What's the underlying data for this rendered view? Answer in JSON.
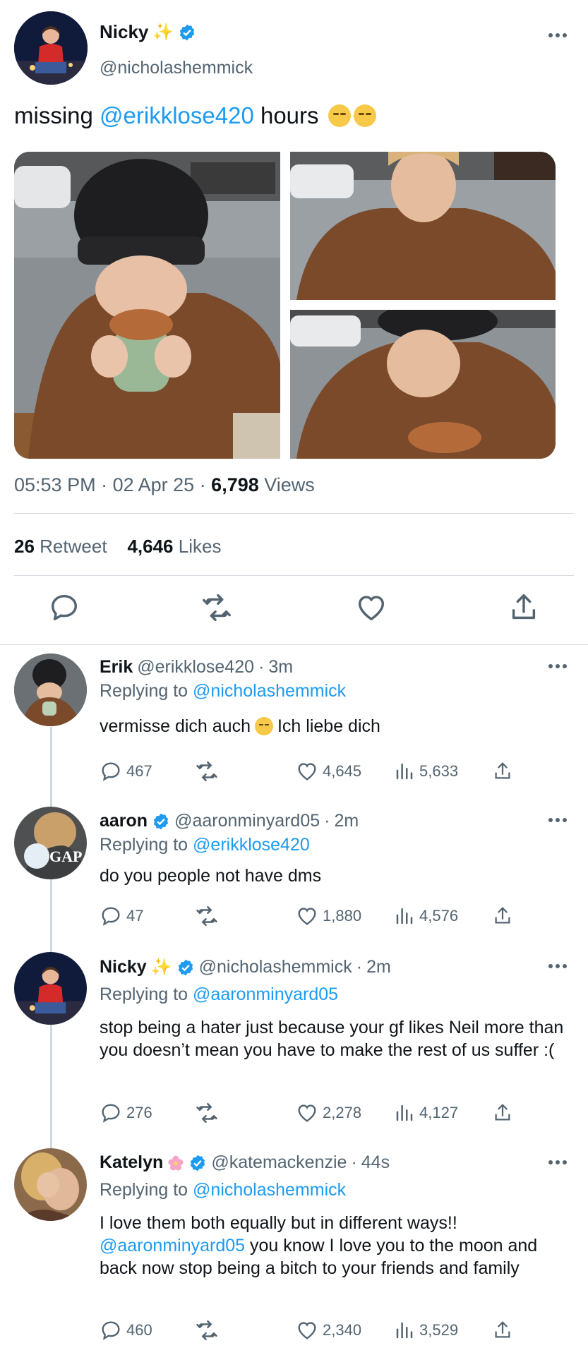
{
  "main_tweet": {
    "name": "Nicky",
    "handle": "@nicholashemmick",
    "text_before": "missing ",
    "mention": "@erikklose420",
    "text_after": " hours",
    "time": "05:53 PM",
    "date": "02 Apr 25",
    "views_count": "6,798",
    "views_label": "Views",
    "retweets_count": "26",
    "retweets_label": "Retweet",
    "likes_count": "4,646",
    "likes_label": "Likes"
  },
  "replies": [
    {
      "name": "Erik",
      "handle": "@erikklose420",
      "time": "3m",
      "replying_label": "Replying to",
      "replying_to": "@nicholashemmick",
      "text_before": "vermisse dich auch",
      "text_after": "Ich liebe dich",
      "comments": "467",
      "likes": "4,645",
      "views": "5,633"
    },
    {
      "name": "aaron",
      "handle": "@aaronminyard05",
      "time": "2m",
      "replying_label": "Replying to",
      "replying_to": "@erikklose420",
      "text": "do you people not have dms",
      "comments": "47",
      "likes": "1,880",
      "views": "4,576"
    },
    {
      "name": "Nicky",
      "handle": "@nicholashemmick",
      "time": "2m",
      "replying_label": "Replying to",
      "replying_to": "@aaronminyard05",
      "text": "stop being a hater just because your gf likes Neil more than you doesn’t mean you have to make the rest of us suffer :(",
      "comments": "276",
      "likes": "2,278",
      "views": "4,127"
    },
    {
      "name": "Katelyn",
      "handle": "@katemackenzie",
      "time": "44s",
      "replying_label": "Replying to",
      "replying_to": "@nicholashemmick",
      "text_line1": "I love them both equally but in different ways!!",
      "mention": "@aaronminyard05",
      "text_rest": " you know I love you to the moon and back now stop being a bitch to your friends and family",
      "comments": "460",
      "likes": "2,340",
      "views": "3,529"
    }
  ],
  "separator": " · ",
  "colors": {
    "link": "#1d9bf0",
    "secondary": "#536471",
    "divider": "#d8dde2"
  },
  "icons": [
    "more-icon",
    "verified-icon",
    "sparkle-icon",
    "reply-icon",
    "retweet-icon",
    "like-icon",
    "share-icon",
    "views-icon",
    "flower-icon"
  ]
}
